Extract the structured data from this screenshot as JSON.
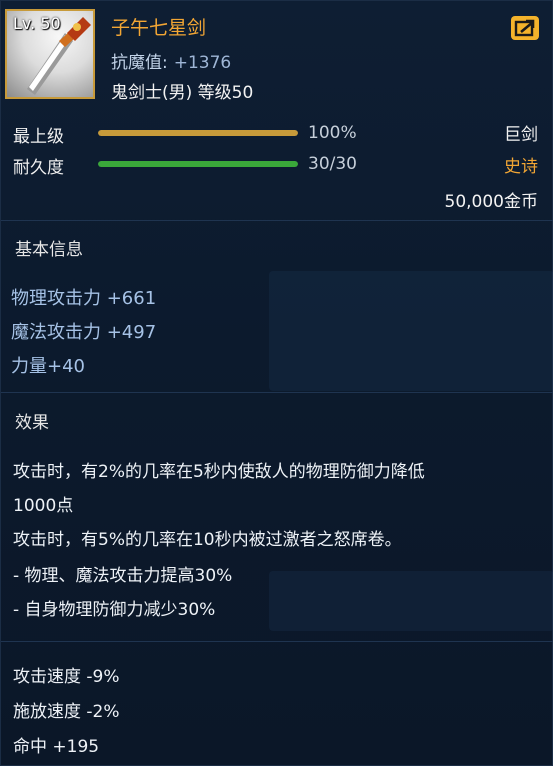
{
  "header": {
    "level_badge": "Lv. 50",
    "item_name": "子午七星剑",
    "resist_label": "抗魔值:",
    "resist_value": "+1376",
    "class_level": "鬼剑士(男) 等级50",
    "share_icon": "share-arrow-icon"
  },
  "grade": {
    "label": "最上级",
    "value_text": "100%",
    "fraction": 1.0,
    "bar_color": "#c79a3a",
    "weapon_type": "巨剑"
  },
  "durability": {
    "label": "耐久度",
    "value_text": "30/30",
    "fraction": 1.0,
    "bar_color": "#3aa83a",
    "rarity": "史诗",
    "rarity_color": "#f2a634"
  },
  "price": "50,000金币",
  "basic_info": {
    "heading": "基本信息",
    "stats": [
      "物理攻击力 +661",
      "魔法攻击力 +497",
      "力量+40"
    ]
  },
  "effect": {
    "heading": "效果",
    "lines": [
      "攻击时，有2%的几率在5秒内使敌人的物理防御力降低",
      "1000点",
      "攻击时，有5%的几率在10秒内被过激者之怒席卷。",
      " - 物理、魔法攻击力提高30%",
      " - 自身物理防御力减少30%"
    ]
  },
  "bottom_stats": [
    "攻击速度 -9%",
    "施放速度 -2%",
    "命中 +195"
  ]
}
